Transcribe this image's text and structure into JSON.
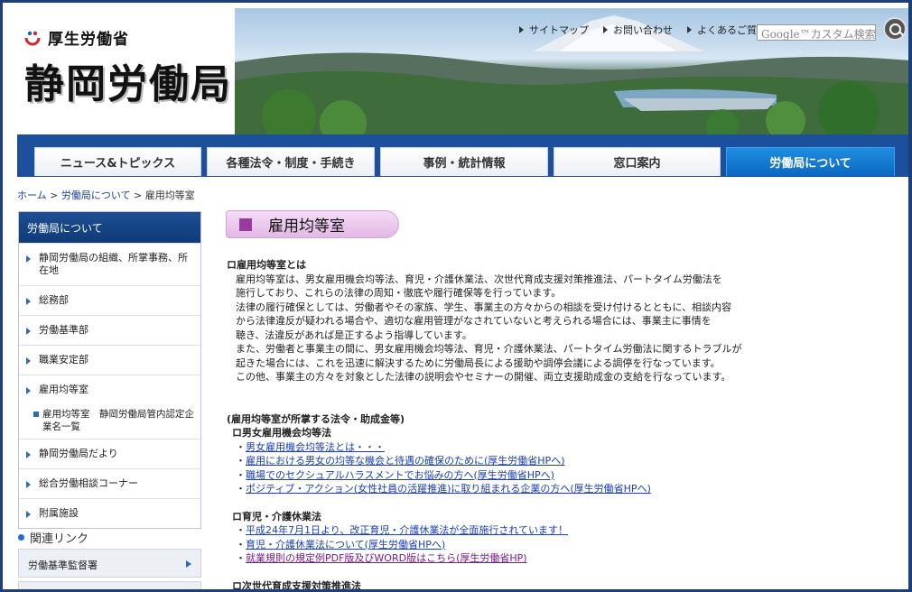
{
  "header": {
    "ministry": "厚生労働省",
    "bureau": "静岡労働局",
    "top_links": [
      "サイトマップ",
      "お問い合わせ",
      "よくあるご質問"
    ],
    "search_placeholder": "Google™カスタム検索"
  },
  "nav": {
    "tabs": [
      "ニュース&トピックス",
      "各種法令・制度・手続き",
      "事例・統計情報",
      "窓口案内",
      "労働局について"
    ],
    "active_tab": "労働局について"
  },
  "breadcrumb": {
    "home": "ホーム",
    "sep": " > ",
    "parent": "労働局について",
    "current": "雇用均等室"
  },
  "sidebar": {
    "heading": "労働局について",
    "items": [
      "静岡労働局の組織、所掌事務、所在地",
      "総務部",
      "労働基準部",
      "職業安定部",
      "雇用均等室"
    ],
    "subitem": "雇用均等室　静岡労働局管内認定企業名一覧",
    "items_after": [
      "静岡労働局だより",
      "総合労働相談コーナー",
      "附属施設"
    ]
  },
  "related": {
    "title": "関連リンク",
    "items": [
      "労働基準監督署"
    ]
  },
  "main": {
    "page_title": "雇用均等室",
    "intro_heading": "ロ雇用均等室とは",
    "intro_lines": [
      "雇用均等室は、男女雇用機会均等法、育児・介護休業法、次世代育成支援対策推進法、パートタイム労働法を",
      "施行しており、これらの法律の周知・徹底や履行確保等を行っています。",
      "法律の履行確保としては、労働者やその家族、学生、事業主の方々からの相談を受け付けるとともに、相談内容",
      "から法律違反が疑われる場合や、適切な雇用管理がなされていないと考えられる場合には、事業主に事情を",
      "聴き、法違反があれば是正するよう指導しています。",
      "また、労働者と事業主の間に、男女雇用機会均等法、育児・介護休業法、パートタイム労働法に関するトラブルが",
      "起きた場合には、これを迅速に解決するために労働局長による援助や調停会議による調停を行なっています。",
      "この他、事業主の方々を対象とした法律の説明会やセミナーの開催、両立支援助成金の支給を行なっています。"
    ],
    "laws_heading": "(雇用均等室が所掌する法令・助成金等)",
    "law_sections": [
      {
        "heading": "ロ男女雇用機会均等法",
        "links": [
          "男女雇用機会均等法とは・・・",
          "雇用における男女の均等な機会と待遇の確保のために(厚生労働省HPへ)",
          "職場でのセクシュアルハラスメントでお悩みの方へ(厚生労働省HPへ)",
          "ポジティブ・アクション(女性社員の活躍推進)に取り組まれる企業の方へ(厚生労働省HPへ)"
        ]
      },
      {
        "heading": "ロ育児・介護休業法",
        "links": [
          "平成24年7月1日より、改正育児・介護休業法が全面施行されています！",
          "育児・介護休業法について(厚生労働省HPへ)",
          "就業規則の規定例PDF版及びWORD版はこちら(厚生労働省HP)"
        ]
      },
      {
        "heading": "ロ次世代育成支援対策推進法",
        "links": []
      }
    ]
  },
  "colors": {
    "nav_blue": "#1c4f9c",
    "active_tab": "#0a68c0",
    "title_pill": "#e3b8e6",
    "link": "#1a3fb8"
  }
}
